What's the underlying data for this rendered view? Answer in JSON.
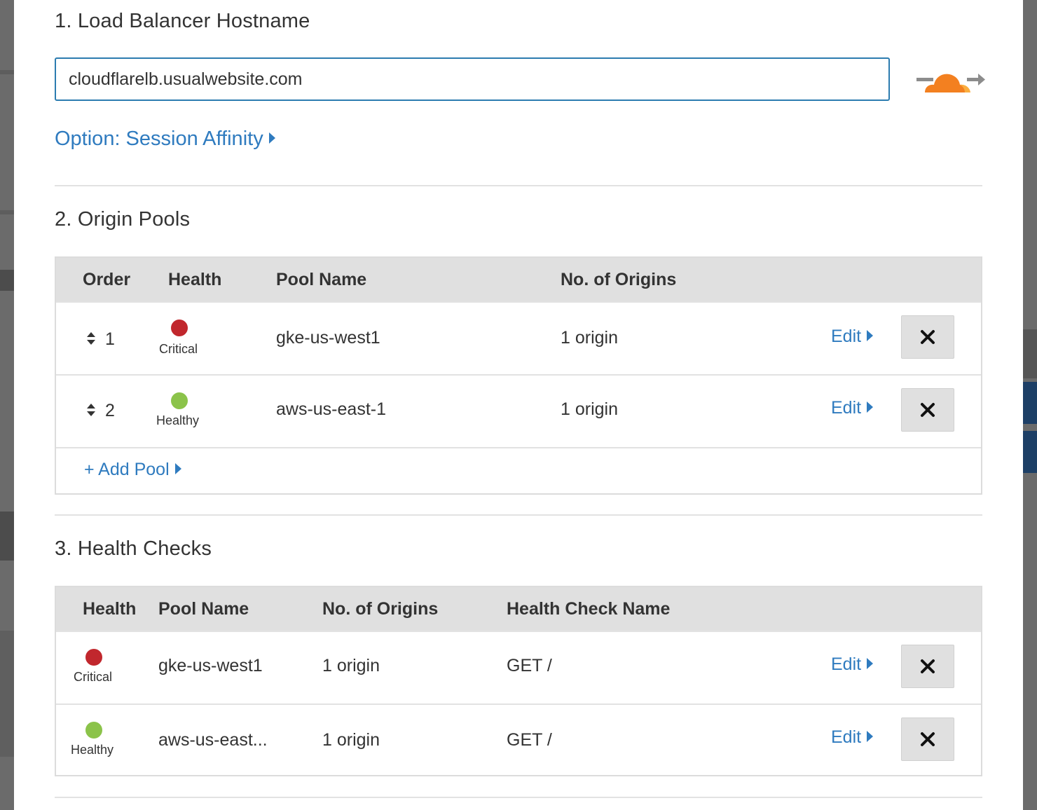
{
  "section1": {
    "title": "1. Load Balancer Hostname",
    "hostname_value": "cloudflarelb.usualwebsite.com",
    "session_affinity_link": "Option: Session Affinity"
  },
  "section2": {
    "title": "2. Origin Pools",
    "headers": {
      "order": "Order",
      "health": "Health",
      "pool_name": "Pool Name",
      "origins": "No. of Origins"
    },
    "rows": [
      {
        "order": "1",
        "health": "Critical",
        "health_color": "#c1272d",
        "pool_name": "gke-us-west1",
        "origins": "1 origin",
        "edit": "Edit"
      },
      {
        "order": "2",
        "health": "Healthy",
        "health_color": "#8bc34a",
        "pool_name": "aws-us-east-1",
        "origins": "1 origin",
        "edit": "Edit"
      }
    ],
    "add_pool_link": "+ Add Pool"
  },
  "section3": {
    "title": "3. Health Checks",
    "headers": {
      "health": "Health",
      "pool_name": "Pool Name",
      "origins": "No. of Origins",
      "check_name": "Health Check Name"
    },
    "rows": [
      {
        "health": "Critical",
        "health_color": "#c1272d",
        "pool_name": "gke-us-west1",
        "origins": "1 origin",
        "check_name": "GET /",
        "edit": "Edit"
      },
      {
        "health": "Healthy",
        "health_color": "#8bc34a",
        "pool_name": "aws-us-east...",
        "origins": "1 origin",
        "check_name": "GET /",
        "edit": "Edit"
      }
    ]
  },
  "icons": {
    "logo": "cloudflare-logo",
    "delete": "close-icon",
    "sort": "sort-arrows-icon",
    "caret": "caret-right-icon"
  },
  "colors": {
    "link": "#2f7bbf",
    "input_border": "#2c7cb0",
    "cloud_orange": "#f38020",
    "header_bg": "#e0e0e0"
  }
}
